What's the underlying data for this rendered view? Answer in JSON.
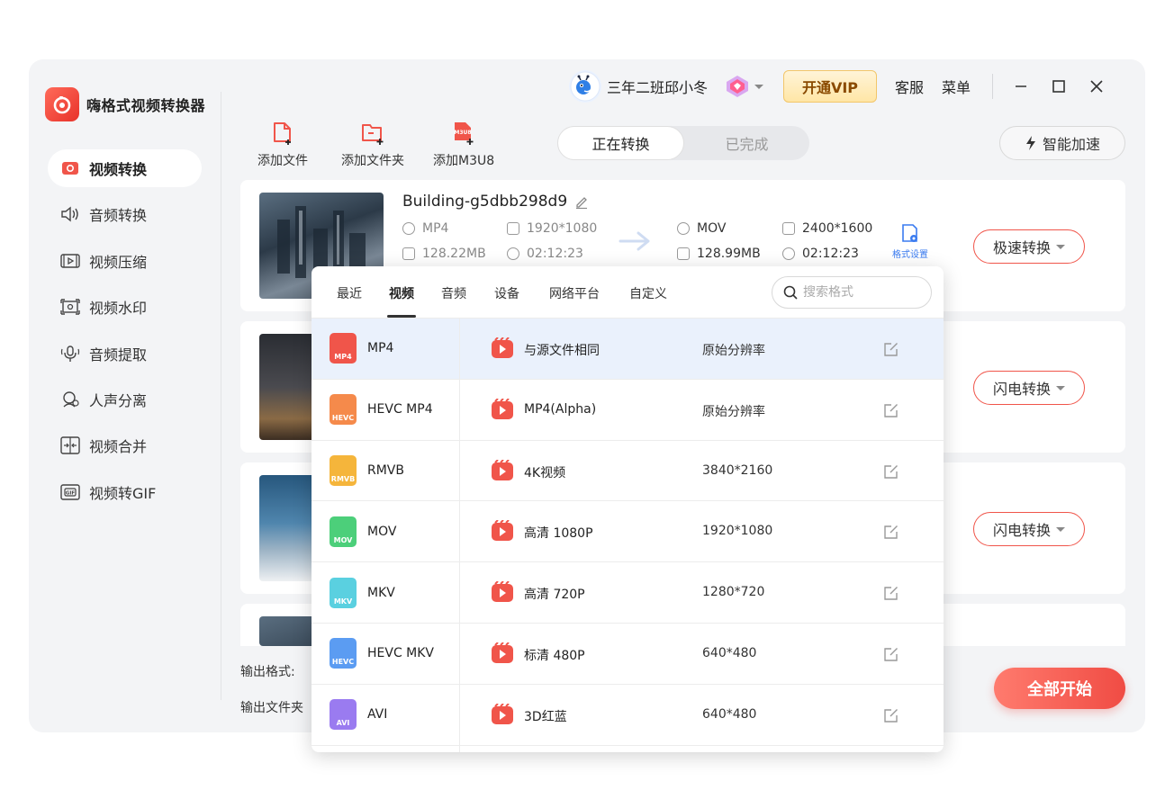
{
  "app": {
    "name": "嗨格式视频转换器"
  },
  "sidebar": {
    "items": [
      {
        "label": "视频转换",
        "icon": "video-convert-icon",
        "active": true
      },
      {
        "label": "音频转换",
        "icon": "audio-convert-icon"
      },
      {
        "label": "视频压缩",
        "icon": "video-compress-icon"
      },
      {
        "label": "视频水印",
        "icon": "video-watermark-icon"
      },
      {
        "label": "音频提取",
        "icon": "audio-extract-icon"
      },
      {
        "label": "人声分离",
        "icon": "vocal-separate-icon"
      },
      {
        "label": "视频合并",
        "icon": "video-merge-icon"
      },
      {
        "label": "视频转GIF",
        "icon": "video-gif-icon"
      }
    ]
  },
  "titlebar": {
    "username": "三年二班邱小冬",
    "vip_label": "开通VIP",
    "service_label": "客服",
    "menu_label": "菜单"
  },
  "toolbar": {
    "add_file": "添加文件",
    "add_folder": "添加文件夹",
    "add_m3u8": "添加M3U8",
    "m3u8_badge": "M3U8",
    "tab_converting": "正在转换",
    "tab_done": "已完成",
    "accelerate": "智能加速"
  },
  "card": {
    "filename": "Building-g5dbb298d9",
    "src_format": "MP4",
    "src_resolution": "1920*1080",
    "src_size": "128.22MB",
    "src_duration": "02:12:23",
    "dst_format": "MOV",
    "dst_resolution": "2400*1600",
    "dst_size": "128.99MB",
    "dst_duration": "02:12:23",
    "format_settings": "格式设置"
  },
  "convert_buttons": [
    "极速转换",
    "闪电转换",
    "闪电转换"
  ],
  "bottom": {
    "output_format_label": "输出格式:",
    "output_folder_label": "输出文件夹",
    "start_all": "全部开始"
  },
  "format_panel": {
    "tabs": [
      "最近",
      "视频",
      "音频",
      "设备",
      "网络平台",
      "自定义"
    ],
    "active_tab": "视频",
    "search_placeholder": "搜索格式",
    "formats": [
      {
        "name": "MP4",
        "badge": "MP4",
        "color": "#f0554a",
        "selected": true
      },
      {
        "name": "HEVC MP4",
        "badge": "HEVC",
        "color": "#f58a4b"
      },
      {
        "name": "RMVB",
        "badge": "RMVB",
        "color": "#f5b53b"
      },
      {
        "name": "MOV",
        "badge": "MOV",
        "color": "#4ccf7a"
      },
      {
        "name": "MKV",
        "badge": "MKV",
        "color": "#5ad0e0"
      },
      {
        "name": "HEVC MKV",
        "badge": "HEVC",
        "color": "#5b9cf2"
      },
      {
        "name": "AVI",
        "badge": "AVI",
        "color": "#9a7bf0"
      }
    ],
    "presets": [
      {
        "name": "与源文件相同",
        "resolution": "原始分辨率",
        "selected": true
      },
      {
        "name": "MP4(Alpha)",
        "resolution": "原始分辨率"
      },
      {
        "name": "4K视频",
        "resolution": "3840*2160"
      },
      {
        "name": "高清 1080P",
        "resolution": "1920*1080"
      },
      {
        "name": "高清 720P",
        "resolution": "1280*720"
      },
      {
        "name": "标清 480P",
        "resolution": "640*480"
      },
      {
        "name": "3D红蓝",
        "resolution": "640*480"
      }
    ]
  },
  "colors": {
    "accent": "#f0554a",
    "link_blue": "#3a7bf0",
    "vip_gold": "#ffe6a6"
  }
}
